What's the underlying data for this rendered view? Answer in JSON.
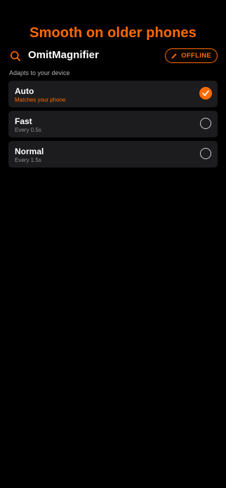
{
  "headline": "Smooth on older phones",
  "app": {
    "title": "OmitMagnifier",
    "icon": "magnifier-icon",
    "badge": {
      "label": "OFFLINE",
      "icon": "pencil-icon"
    }
  },
  "section_label": "Adapts to your device",
  "options": [
    {
      "title": "Auto",
      "subtitle": "Matches your phone",
      "selected": true
    },
    {
      "title": "Fast",
      "subtitle": "Every 0.5s",
      "selected": false
    },
    {
      "title": "Normal",
      "subtitle": "Every 1.5s",
      "selected": false
    }
  ],
  "colors": {
    "accent": "#ff6a00",
    "background": "#000000",
    "card": "#1c1c1e",
    "muted_text": "#8e8e93"
  }
}
